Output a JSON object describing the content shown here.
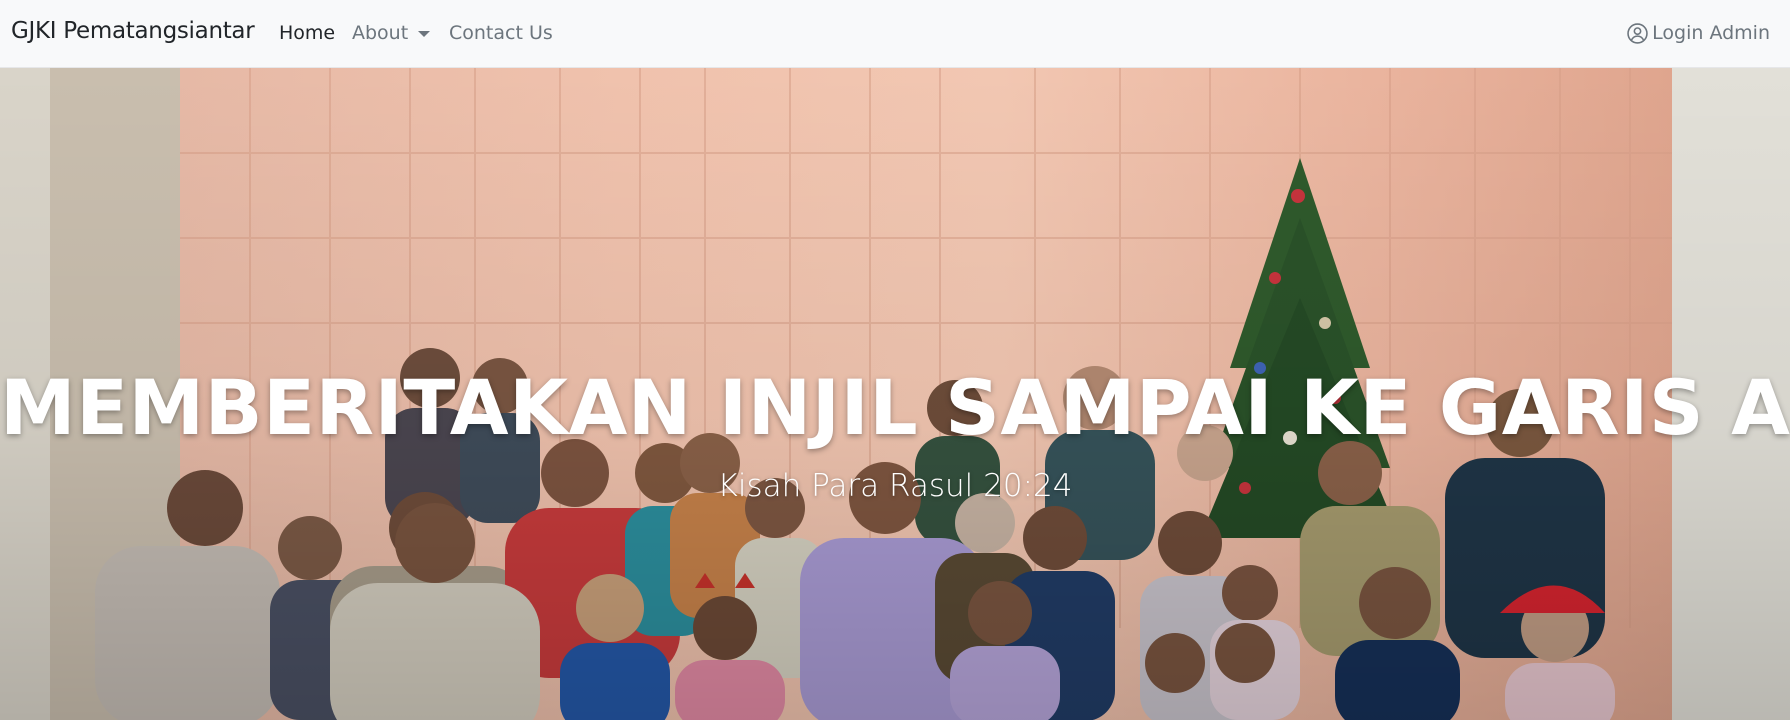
{
  "navbar": {
    "brand": "GJKI Pematangsiantar",
    "links": {
      "home": "Home",
      "about": "About",
      "contact": "Contact Us"
    },
    "login": "Login Admin",
    "icons": {
      "dropdown": "chevron-down-icon",
      "login": "user-circle-icon"
    }
  },
  "hero": {
    "title": "MEMBERITAKAN INJIL SAMPAI KE GARIS AKHIR",
    "subtitle": "Kisah Para Rasul 20:24",
    "image": "church-congregation-group-photo"
  },
  "colors": {
    "navbar_bg": "#f8f9fa",
    "nav_active": "#212529",
    "nav_muted": "#6c757d",
    "hero_text": "#ffffff"
  }
}
